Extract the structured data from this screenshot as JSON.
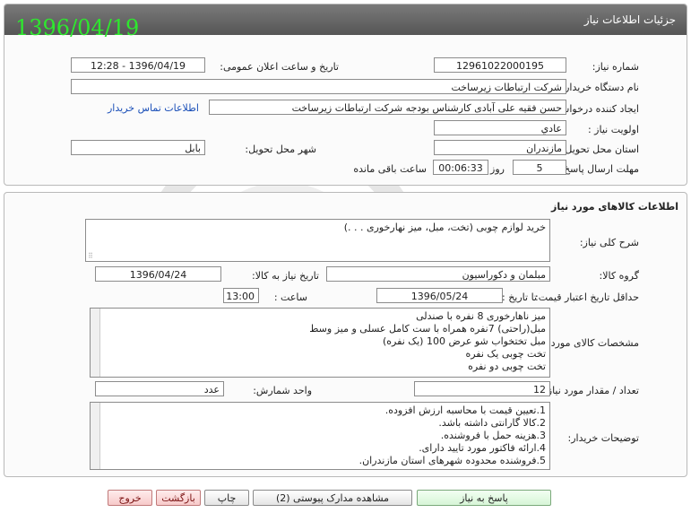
{
  "header": {
    "title": "جزئیات اطلاعات نیاز",
    "date_stamp": "1396/04/19"
  },
  "info": {
    "need_number_label": "شماره نیاز:",
    "need_number": "12961022000195",
    "announce_label": "تاریخ و ساعت اعلان عمومی:",
    "announce_value": "1396/04/19 - 12:28",
    "buyer_org_label": "نام دستگاه خریدار:",
    "buyer_org": "شرکت ارتباطات زیرساخت",
    "creator_label": "ایجاد کننده درخواست:",
    "creator": "حسن فقیه علی آبادی کارشناس بودجه شرکت ارتباطات زیرساخت",
    "contact_link": "اطلاعات تماس خریدار",
    "priority_label": "اولویت نیاز :",
    "priority": "عادي",
    "province_label": "استان محل تحویل:",
    "province": "مازندران",
    "city_label": "شهر محل تحویل:",
    "city": "بابل",
    "deadline_label": "مهلت ارسال پاسخ:",
    "deadline_days": "5",
    "days_label": "روز و",
    "deadline_time": "00:06:33",
    "remaining_label": "ساعت باقی مانده"
  },
  "goods": {
    "section_title": "اطلاعات کالاهای مورد نیاز",
    "desc_label": "شرح کلی نیاز:",
    "desc": "خرید لوازم چوبی (تخت، مبل، میز نهارخوری . . .)",
    "group_label": "گروه کالا:",
    "group": "مبلمان و دکوراسیون",
    "need_date_label": "تاریخ نیاز به کالا:",
    "need_date": "1396/04/24",
    "min_validity_label": "حداقل تاریخ اعتبار قیمت:",
    "to_date_label": "تا تاریخ :",
    "to_date": "1396/05/24",
    "time_label": "ساعت :",
    "time": "13:00",
    "specs_label": "مشخصات کالای مورد نیاز:",
    "specs": [
      "میز ناهارخوری 8 نفره با صندلی",
      "مبل(راحتی) 7نفره همراه با ست کامل عسلی و میز وسط",
      "مبل تختخواب شو عرض 100 (یک نفره)",
      "تخت چوبی یک نفره",
      "تخت چوبی دو نفره"
    ],
    "qty_label": "تعداد / مقدار مورد نیاز:",
    "qty": "12",
    "unit_label": "واحد شمارش:",
    "unit": "عدد",
    "buyer_notes_label": "توضیحات خریدار:",
    "buyer_notes": [
      "1.تعیین قیمت با محاسبه ارزش افزوده.",
      "2.کالا گارانتی داشته باشد.",
      "3.هزینه حمل با فروشنده.",
      "4.ارائه فاکتور مورد تایید دارای.",
      "5.فروشنده محدوده شهرهای استان مازندران."
    ]
  },
  "buttons": {
    "reply": "پاسخ به نیاز",
    "view_docs": "مشاهده مدارک پیوستی (2)",
    "print": "چاپ",
    "back": "بازگشت",
    "exit": "خروج"
  }
}
